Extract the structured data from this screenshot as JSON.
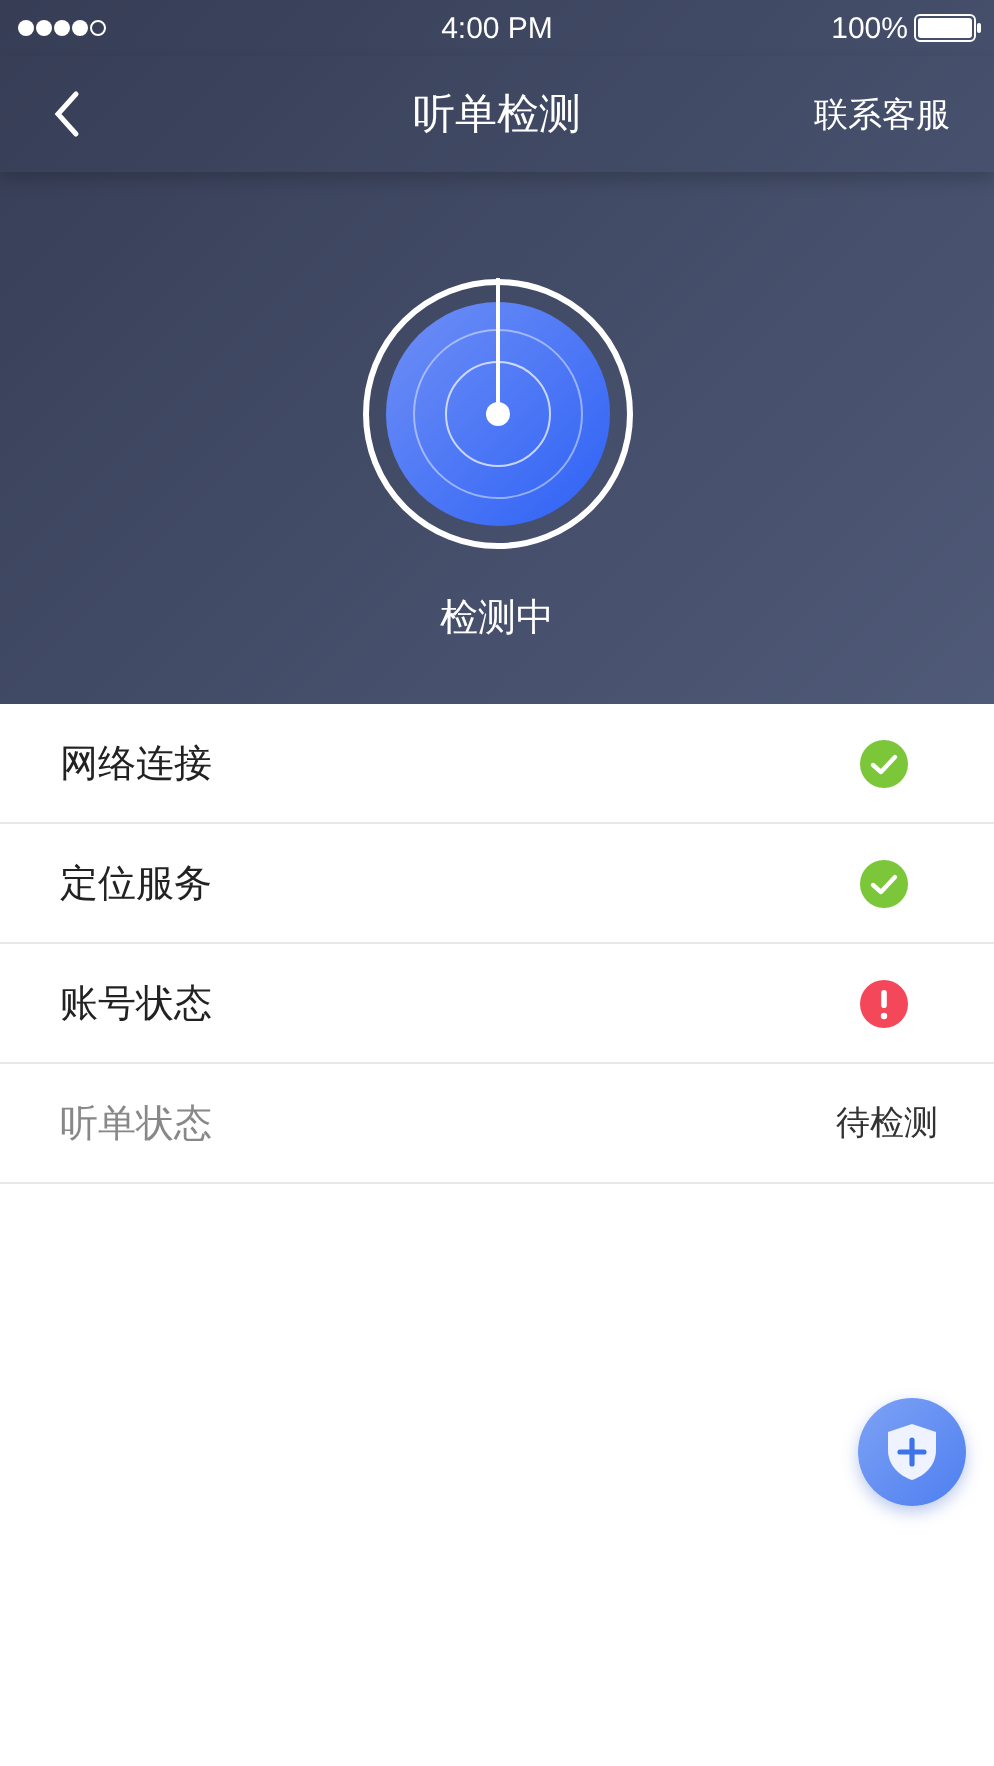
{
  "status_bar": {
    "time": "4:00 PM",
    "battery": "100%"
  },
  "nav": {
    "title": "听单检测",
    "action": "联系客服"
  },
  "scan": {
    "label": "检测中"
  },
  "checks": [
    {
      "label": "网络连接",
      "kind": "ok",
      "disabled": false
    },
    {
      "label": "定位服务",
      "kind": "ok",
      "disabled": false
    },
    {
      "label": "账号状态",
      "kind": "error",
      "disabled": false
    },
    {
      "label": "听单状态",
      "kind": "text",
      "value": "待检测",
      "disabled": true
    }
  ]
}
